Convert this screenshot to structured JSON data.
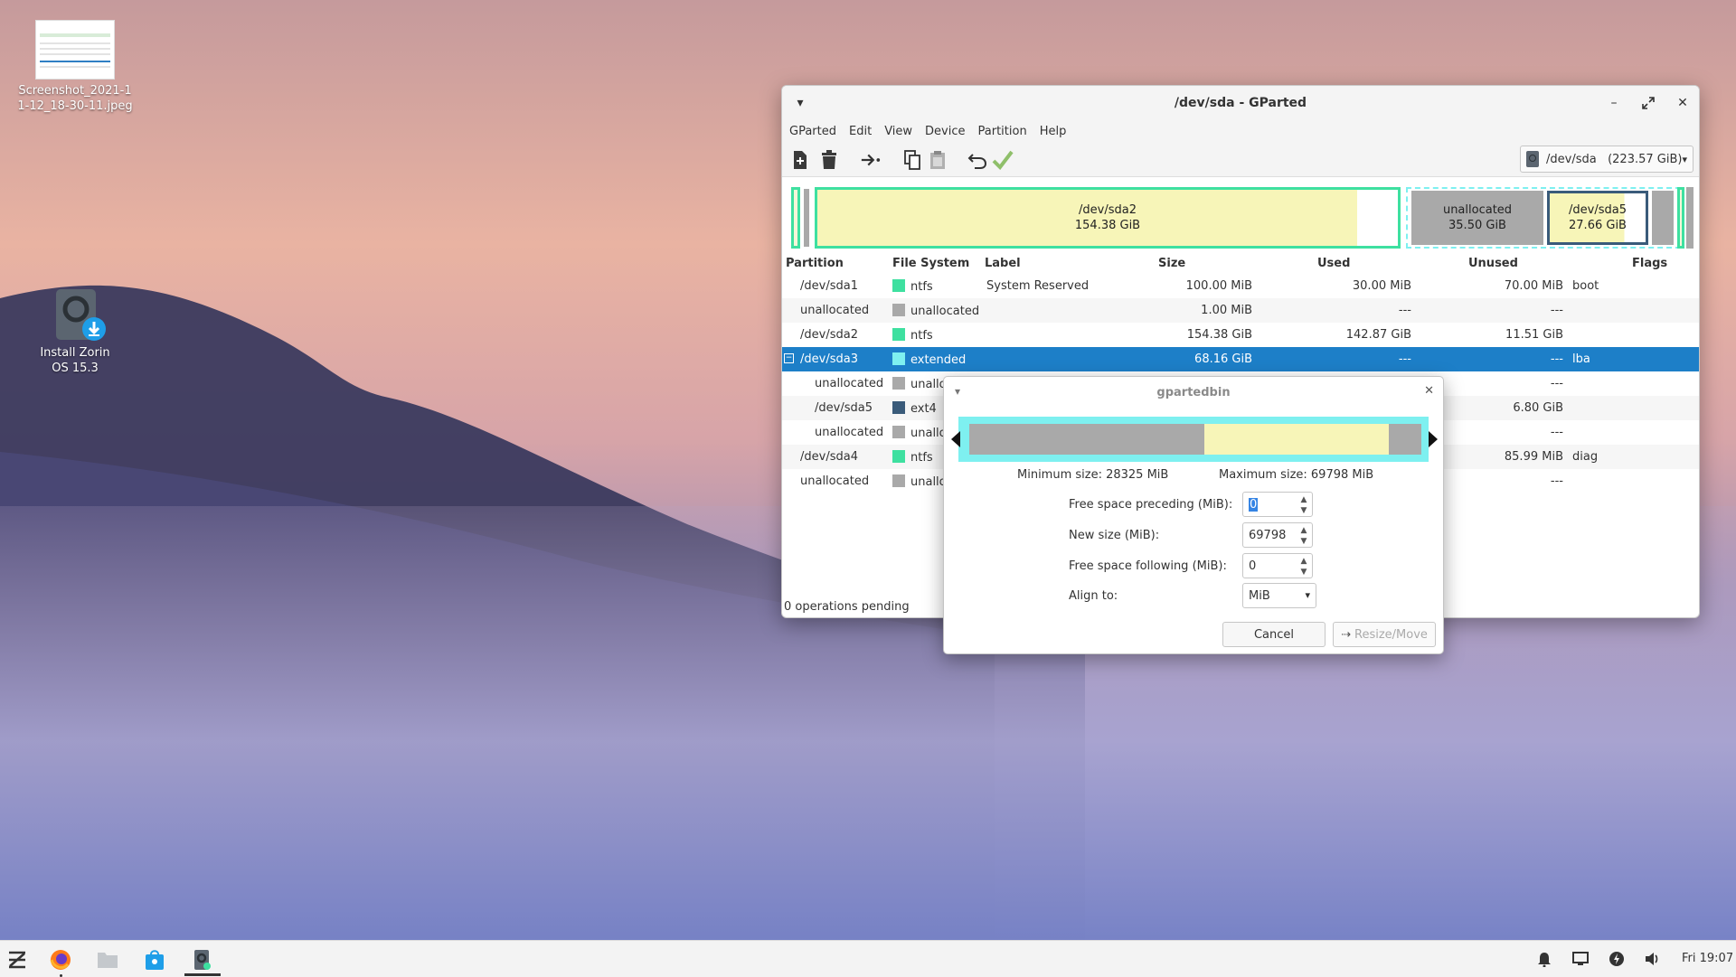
{
  "desktop": {
    "icons": [
      {
        "label": "Screenshot_2021-11-12_18-30-11.jpeg"
      },
      {
        "label": "Install Zorin OS 15.3"
      }
    ]
  },
  "window": {
    "title": "/dev/sda - GParted",
    "menu": [
      "GParted",
      "Edit",
      "View",
      "Device",
      "Partition",
      "Help"
    ],
    "device_selector": "/dev/sda   (223.57 GiB)",
    "diskmap": {
      "sda2": {
        "name": "/dev/sda2",
        "size": "154.38 GiB"
      },
      "unallocated": {
        "name": "unallocated",
        "size": "35.50 GiB"
      },
      "sda5": {
        "name": "/dev/sda5",
        "size": "27.66 GiB"
      }
    },
    "columns": {
      "partition": "Partition",
      "filesystem": "File System",
      "label": "Label",
      "size": "Size",
      "used": "Used",
      "unused": "Unused",
      "flags": "Flags"
    },
    "rows": [
      {
        "partition": "/dev/sda1",
        "fs": "ntfs",
        "fs_color": "#3ee0a0",
        "label": "System Reserved",
        "size": "100.00 MiB",
        "used": "30.00 MiB",
        "unused": "70.00 MiB",
        "flags": "boot"
      },
      {
        "partition": "unallocated",
        "fs": "unallocated",
        "fs_color": "#a9a9a9",
        "label": "",
        "size": "1.00 MiB",
        "used": "---",
        "unused": "---",
        "flags": ""
      },
      {
        "partition": "/dev/sda2",
        "fs": "ntfs",
        "fs_color": "#3ee0a0",
        "label": "",
        "size": "154.38 GiB",
        "used": "142.87 GiB",
        "unused": "11.51 GiB",
        "flags": ""
      },
      {
        "partition": "/dev/sda3",
        "fs": "extended",
        "fs_color": "#7ef0f0",
        "label": "",
        "size": "68.16 GiB",
        "used": "---",
        "unused": "---",
        "flags": "lba"
      },
      {
        "partition": "unallocated",
        "fs": "unallo",
        "fs_color": "#a9a9a9",
        "label": "",
        "size": "",
        "used": "",
        "unused": "---",
        "flags": ""
      },
      {
        "partition": "/dev/sda5",
        "fs": "ext4",
        "fs_color": "#3a5b7a",
        "label": "",
        "size": "",
        "used": "",
        "unused": "6.80 GiB",
        "flags": ""
      },
      {
        "partition": "unallocated",
        "fs": "unallo",
        "fs_color": "#a9a9a9",
        "label": "",
        "size": "",
        "used": "",
        "unused": "---",
        "flags": ""
      },
      {
        "partition": "/dev/sda4",
        "fs": "ntfs",
        "fs_color": "#3ee0a0",
        "label": "",
        "size": "",
        "used": "",
        "unused": "85.99 MiB",
        "flags": "diag"
      },
      {
        "partition": "unallocated",
        "fs": "unallo",
        "fs_color": "#a9a9a9",
        "label": "",
        "size": "",
        "used": "",
        "unused": "---",
        "flags": ""
      }
    ],
    "status": "0 operations pending"
  },
  "dialog": {
    "title": "gpartedbin",
    "min_size": "Minimum size: 28325 MiB",
    "max_size": "Maximum size: 69798 MiB",
    "free_preceding_label": "Free space preceding (MiB):",
    "free_preceding_value": "0",
    "new_size_label": "New size (MiB):",
    "new_size_value": "69798",
    "free_following_label": "Free space following (MiB):",
    "free_following_value": "0",
    "align_label": "Align to:",
    "align_value": "MiB",
    "cancel": "Cancel",
    "resize_move": "Resize/Move"
  },
  "taskbar": {
    "clock": "Fri 19:07"
  }
}
